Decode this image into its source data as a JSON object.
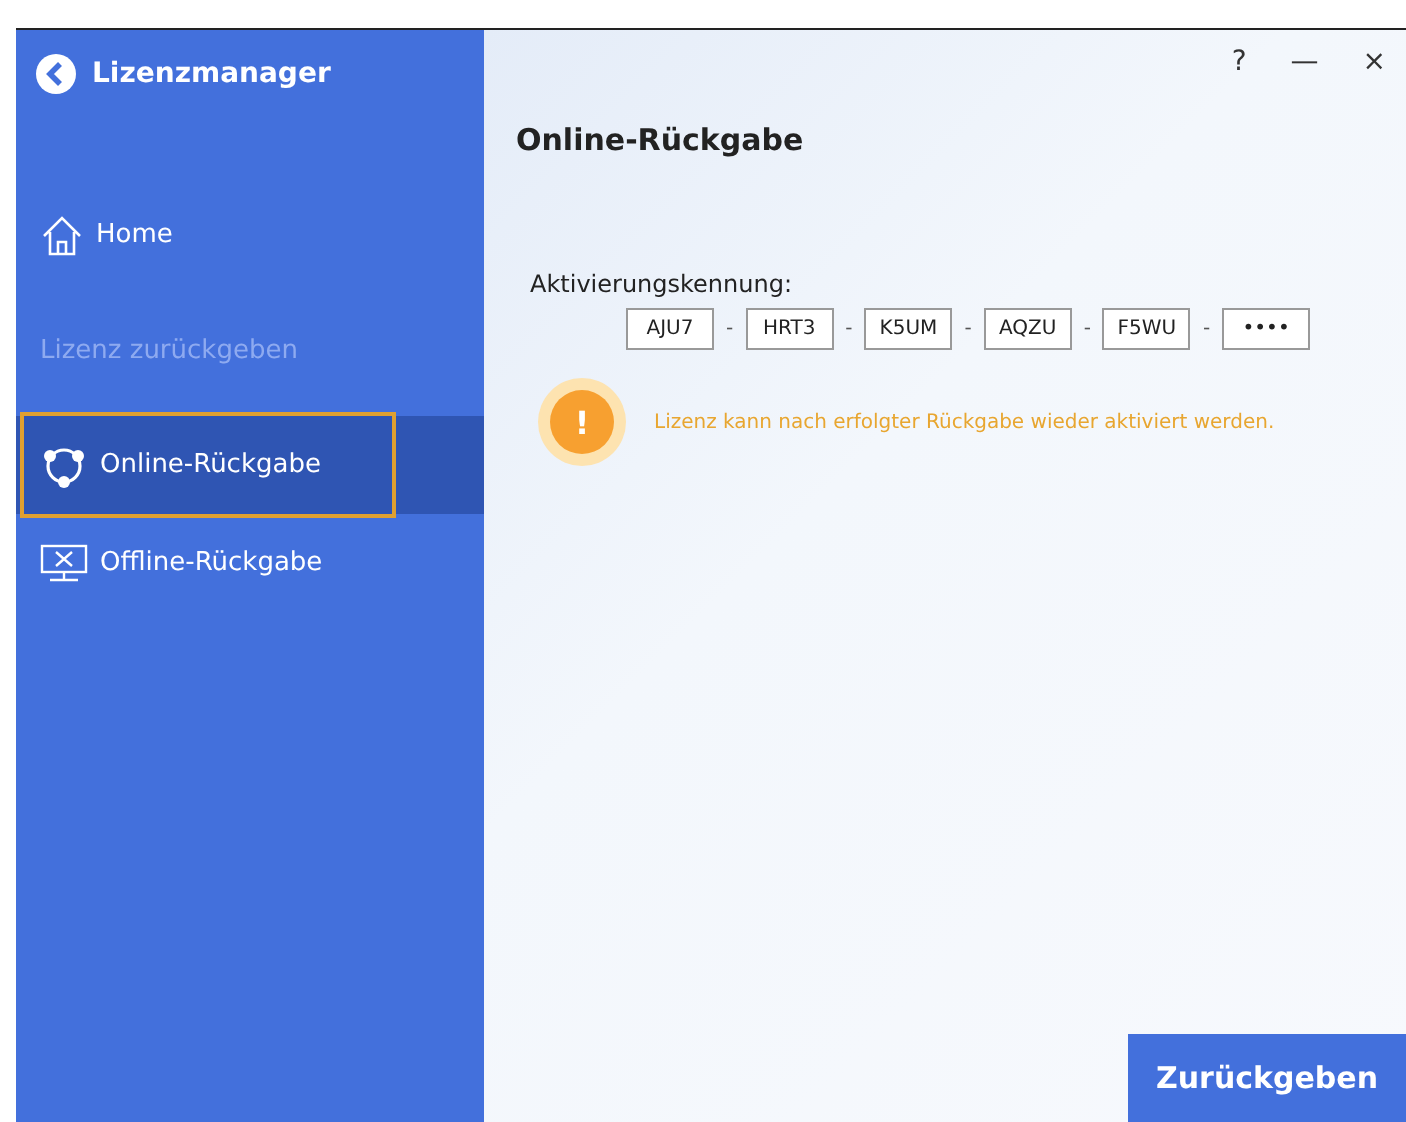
{
  "window": {
    "title": "Lizenzmanager",
    "controls": [
      "?",
      "—",
      "×"
    ]
  },
  "sidebar": {
    "items": [
      {
        "kind": "link",
        "label": "Home",
        "selected": false
      },
      {
        "kind": "section",
        "label": "Lizenz zurückgeben"
      },
      {
        "kind": "link",
        "label": "Online-Rückgabe",
        "selected": true
      },
      {
        "kind": "link",
        "label": "Offline-Rückgabe",
        "selected": false
      }
    ]
  },
  "content": {
    "heading": "Online-Rückgabe",
    "code_label": "Aktivierungskennung:",
    "code_parts": [
      {
        "kind": "field",
        "text": "AJU7"
      },
      {
        "kind": "separator",
        "text": "-"
      },
      {
        "kind": "field",
        "text": "HRT3"
      },
      {
        "kind": "separator",
        "text": "-"
      },
      {
        "kind": "field",
        "text": "K5UM"
      },
      {
        "kind": "separator",
        "text": "-"
      },
      {
        "kind": "field",
        "text": "AQZU"
      },
      {
        "kind": "separator",
        "text": "-"
      },
      {
        "kind": "field",
        "text": "F5WU"
      },
      {
        "kind": "separator",
        "text": "-"
      },
      {
        "kind": "field",
        "text": "••••"
      }
    ],
    "notice": {
      "icon": "!",
      "text": "Lizenz kann nach erfolgter Rückgabe wieder aktiviert werden."
    },
    "submit": "Zurückgeben"
  }
}
